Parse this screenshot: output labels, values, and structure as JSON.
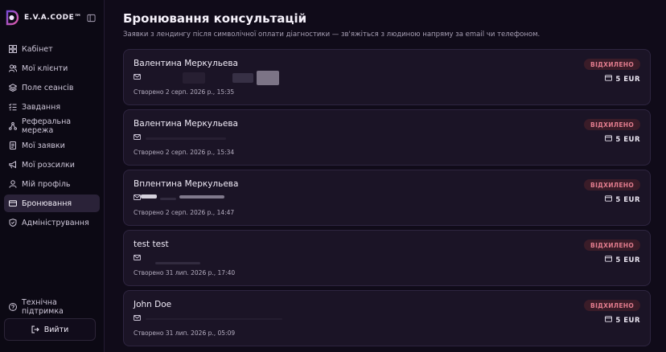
{
  "brand": {
    "name": "E.V.A.CODE™"
  },
  "sidebar": {
    "items": [
      {
        "label": "Кабінет",
        "icon": "dashboard-icon",
        "active": false
      },
      {
        "label": "Мої клієнти",
        "icon": "users-icon",
        "active": false
      },
      {
        "label": "Поле сеансів",
        "icon": "layers-icon",
        "active": false
      },
      {
        "label": "Завдання",
        "icon": "tasks-icon",
        "active": false
      },
      {
        "label": "Реферальна мережа",
        "icon": "network-icon",
        "active": false
      },
      {
        "label": "Мої заявки",
        "icon": "document-icon",
        "active": false
      },
      {
        "label": "Мої розсилки",
        "icon": "megaphone-icon",
        "active": false
      },
      {
        "label": "Мій профіль",
        "icon": "user-icon",
        "active": false
      },
      {
        "label": "Бронювання",
        "icon": "card-icon",
        "active": true
      },
      {
        "label": "Адміністрування",
        "icon": "shield-icon",
        "active": false
      }
    ],
    "support_label": "Технічна підтримка",
    "logout_label": "Вийти"
  },
  "main": {
    "title": "Бронювання консультацій",
    "subtitle": "Заявки з лендингу після символічної оплати діагностики — зв'яжіться з людиною напряму за email чи телефоном.",
    "bookings": [
      {
        "name": "Валентина Меркульева",
        "created": "Створено 2 серп. 2026 р., 15:35",
        "status": "ВІДХИЛЕНО",
        "amount": "5",
        "currency": "EUR"
      },
      {
        "name": "Валентина Меркульева",
        "created": "Створено 2 серп. 2026 р., 15:34",
        "status": "ВІДХИЛЕНО",
        "amount": "5",
        "currency": "EUR"
      },
      {
        "name": "Вплентина Меркульева",
        "created": "Створено 2 серп. 2026 р., 14:47",
        "status": "ВІДХИЛЕНО",
        "amount": "5",
        "currency": "EUR"
      },
      {
        "name": "test test",
        "created": "Створено 31 лип. 2026 р., 17:40",
        "status": "ВІДХИЛЕНО",
        "amount": "5",
        "currency": "EUR"
      },
      {
        "name": "John Doe",
        "created": "Створено 31 лип. 2026 р., 05:09",
        "status": "ВІДХИЛЕНО",
        "amount": "5",
        "currency": "EUR"
      }
    ]
  },
  "colors": {
    "background": "#100b19",
    "card": "#1b1426",
    "status_bg": "#3a1c28",
    "status_text": "#e07b8c",
    "accent": "#b06bd9"
  }
}
